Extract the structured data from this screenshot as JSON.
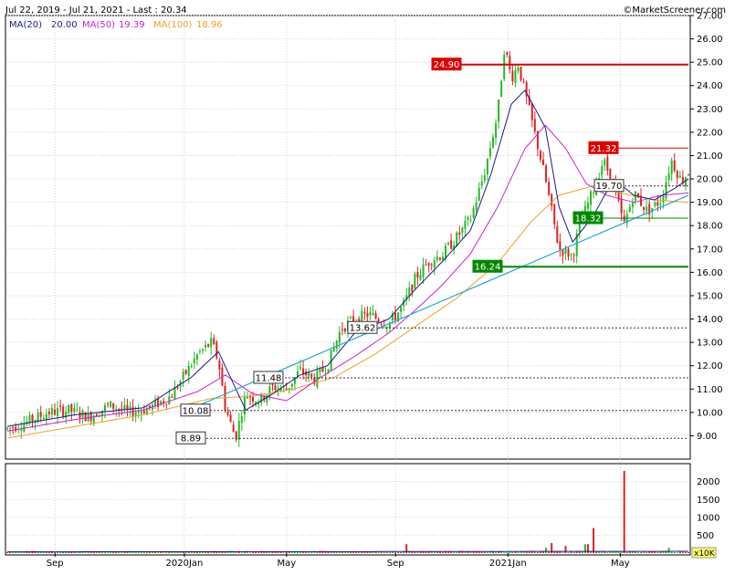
{
  "header": {
    "range": "Jul 22, 2019 - Jul 21, 2021 - Last : 20.34",
    "brand": "©MarketScreener.com"
  },
  "legend": [
    {
      "label": "MA(20)",
      "value": "20.00",
      "color": "#1a1a8c"
    },
    {
      "label": "MA(50)",
      "value": "19.39",
      "color": "#cc22cc"
    },
    {
      "label": "MA(100)",
      "value": "18.96",
      "color": "#f0a020"
    }
  ],
  "colors": {
    "up": "#22bb22",
    "down": "#dd2222",
    "trend": "#22a8d8",
    "resistance": "#dd0000",
    "support": "#008800",
    "grid": "#d0d0d0"
  },
  "chart_data": {
    "type": "line",
    "x_ticks": [
      "Sep",
      "2020Jan",
      "May",
      "Sep",
      "2021Jan",
      "May"
    ],
    "price_axis": {
      "min": 8,
      "max": 27,
      "ticks": [
        "9.00",
        "10.00",
        "11.00",
        "12.00",
        "13.00",
        "14.00",
        "15.00",
        "16.00",
        "17.00",
        "18.00",
        "19.00",
        "20.00",
        "21.00",
        "22.00",
        "23.00",
        "24.00",
        "25.00",
        "26.00",
        "27.00"
      ]
    },
    "volume_axis": {
      "min": 0,
      "max": 2300,
      "ticks": [
        "500",
        "1000",
        "1500",
        "2000"
      ],
      "unit": "x10K"
    },
    "levels": [
      {
        "value": 24.9,
        "label": "24.90",
        "kind": "resistance"
      },
      {
        "value": 21.32,
        "label": "21.32",
        "kind": "resistance"
      },
      {
        "value": 19.7,
        "label": "19.70",
        "kind": "neutral"
      },
      {
        "value": 18.32,
        "label": "18.32",
        "kind": "support"
      },
      {
        "value": 16.24,
        "label": "16.24",
        "kind": "support"
      },
      {
        "value": 13.62,
        "label": "13.62",
        "kind": "neutral"
      },
      {
        "value": 11.48,
        "label": "11.48",
        "kind": "neutral"
      },
      {
        "value": 10.08,
        "label": "10.08",
        "kind": "neutral"
      },
      {
        "value": 8.89,
        "label": "8.89",
        "kind": "neutral"
      }
    ],
    "price_keypoints": [
      [
        0,
        9.3
      ],
      [
        0.03,
        9.6
      ],
      [
        0.06,
        10.0
      ],
      [
        0.09,
        10.1
      ],
      [
        0.12,
        9.8
      ],
      [
        0.15,
        10.3
      ],
      [
        0.18,
        10.0
      ],
      [
        0.21,
        10.2
      ],
      [
        0.24,
        10.7
      ],
      [
        0.26,
        11.6
      ],
      [
        0.28,
        12.5
      ],
      [
        0.3,
        13.0
      ],
      [
        0.31,
        12.2
      ],
      [
        0.32,
        10.2
      ],
      [
        0.335,
        8.9
      ],
      [
        0.35,
        10.8
      ],
      [
        0.37,
        10.5
      ],
      [
        0.39,
        11.1
      ],
      [
        0.41,
        11.0
      ],
      [
        0.43,
        11.8
      ],
      [
        0.45,
        11.4
      ],
      [
        0.47,
        12.0
      ],
      [
        0.49,
        13.6
      ],
      [
        0.51,
        14.0
      ],
      [
        0.53,
        14.2
      ],
      [
        0.56,
        13.8
      ],
      [
        0.58,
        14.5
      ],
      [
        0.6,
        15.8
      ],
      [
        0.62,
        16.5
      ],
      [
        0.64,
        16.8
      ],
      [
        0.66,
        17.5
      ],
      [
        0.68,
        18.3
      ],
      [
        0.7,
        20.2
      ],
      [
        0.72,
        22.8
      ],
      [
        0.73,
        25.7
      ],
      [
        0.74,
        24.3
      ],
      [
        0.75,
        24.9
      ],
      [
        0.77,
        22.5
      ],
      [
        0.79,
        20.0
      ],
      [
        0.81,
        17.0
      ],
      [
        0.83,
        16.7
      ],
      [
        0.84,
        18.0
      ],
      [
        0.86,
        19.5
      ],
      [
        0.875,
        20.8
      ],
      [
        0.89,
        19.8
      ],
      [
        0.905,
        18.0
      ],
      [
        0.92,
        19.4
      ],
      [
        0.94,
        18.6
      ],
      [
        0.96,
        19.1
      ],
      [
        0.975,
        20.8
      ],
      [
        0.99,
        19.9
      ],
      [
        1.0,
        20.3
      ]
    ],
    "ma20_keypoints": [
      [
        0,
        9.4
      ],
      [
        0.1,
        9.9
      ],
      [
        0.2,
        10.2
      ],
      [
        0.27,
        11.5
      ],
      [
        0.31,
        12.6
      ],
      [
        0.35,
        10.1
      ],
      [
        0.39,
        10.8
      ],
      [
        0.43,
        11.6
      ],
      [
        0.47,
        12.0
      ],
      [
        0.51,
        13.4
      ],
      [
        0.56,
        14.0
      ],
      [
        0.6,
        15.3
      ],
      [
        0.64,
        16.5
      ],
      [
        0.68,
        17.8
      ],
      [
        0.71,
        20.2
      ],
      [
        0.74,
        23.2
      ],
      [
        0.76,
        23.8
      ],
      [
        0.79,
        22.2
      ],
      [
        0.81,
        18.8
      ],
      [
        0.83,
        17.3
      ],
      [
        0.86,
        18.4
      ],
      [
        0.89,
        20.0
      ],
      [
        0.92,
        19.3
      ],
      [
        0.95,
        19.1
      ],
      [
        0.98,
        19.6
      ],
      [
        1.0,
        20.0
      ]
    ],
    "ma50_keypoints": [
      [
        0,
        9.2
      ],
      [
        0.1,
        9.7
      ],
      [
        0.2,
        10.1
      ],
      [
        0.28,
        10.9
      ],
      [
        0.32,
        11.6
      ],
      [
        0.36,
        10.8
      ],
      [
        0.41,
        10.5
      ],
      [
        0.46,
        11.5
      ],
      [
        0.51,
        12.4
      ],
      [
        0.56,
        13.4
      ],
      [
        0.6,
        14.4
      ],
      [
        0.64,
        15.5
      ],
      [
        0.68,
        16.8
      ],
      [
        0.72,
        18.8
      ],
      [
        0.76,
        21.3
      ],
      [
        0.79,
        22.3
      ],
      [
        0.82,
        21.3
      ],
      [
        0.85,
        19.8
      ],
      [
        0.88,
        19.3
      ],
      [
        0.92,
        19.0
      ],
      [
        0.96,
        19.3
      ],
      [
        1.0,
        19.4
      ]
    ],
    "ma100_keypoints": [
      [
        0,
        8.9
      ],
      [
        0.1,
        9.4
      ],
      [
        0.2,
        9.9
      ],
      [
        0.3,
        10.6
      ],
      [
        0.36,
        10.7
      ],
      [
        0.42,
        11.0
      ],
      [
        0.48,
        11.5
      ],
      [
        0.54,
        12.5
      ],
      [
        0.6,
        13.7
      ],
      [
        0.66,
        14.9
      ],
      [
        0.72,
        16.4
      ],
      [
        0.77,
        18.2
      ],
      [
        0.81,
        19.3
      ],
      [
        0.86,
        19.7
      ],
      [
        0.9,
        19.4
      ],
      [
        0.95,
        19.1
      ],
      [
        1.0,
        19.0
      ]
    ],
    "trendline": [
      [
        0.265,
        10.1
      ],
      [
        1.0,
        19.3
      ]
    ],
    "volume_spikes": [
      [
        0.587,
        250
      ],
      [
        0.79,
        150
      ],
      [
        0.8,
        280
      ],
      [
        0.82,
        200
      ],
      [
        0.85,
        250
      ],
      [
        0.86,
        700
      ],
      [
        0.905,
        2300
      ],
      [
        0.97,
        150
      ]
    ]
  }
}
